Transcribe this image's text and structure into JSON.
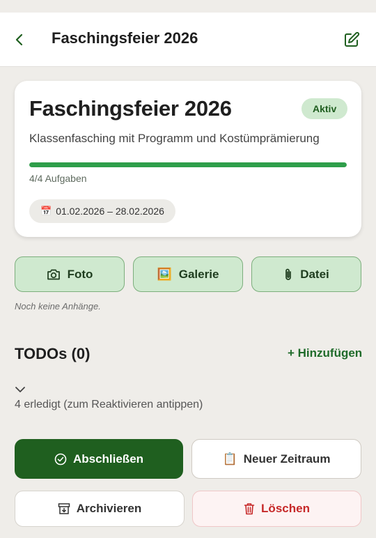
{
  "appbar": {
    "title": "Faschingsfeier 2026"
  },
  "event": {
    "title": "Faschingsfeier 2026",
    "status": "Aktiv",
    "description": "Klassenfasching mit Programm und Kostümprämierung",
    "progress_fraction": 1.0,
    "progress_text": "4/4 Aufgaben",
    "date_icon": "📅",
    "date_range": "01.02.2026 – 28.02.2026"
  },
  "attachments": {
    "photo_label": "Foto",
    "gallery_icon": "🖼️",
    "gallery_label": "Galerie",
    "file_label": "Datei",
    "empty_text": "Noch keine Anhänge."
  },
  "todos": {
    "title": "TODOs (0)",
    "add_label": "+ Hinzufügen",
    "done_text": "4 erledigt (zum Reaktivieren antippen)"
  },
  "actions": {
    "complete_label": "Abschließen",
    "period_icon": "📋",
    "period_label": "Neuer Zeitraum",
    "archive_label": "Archivieren",
    "delete_label": "Löschen"
  },
  "colors": {
    "primary": "#1f5f1f",
    "progress": "#2e9e4a",
    "badge_bg": "#cfe9cf",
    "danger": "#c62828",
    "background": "#efede9"
  }
}
